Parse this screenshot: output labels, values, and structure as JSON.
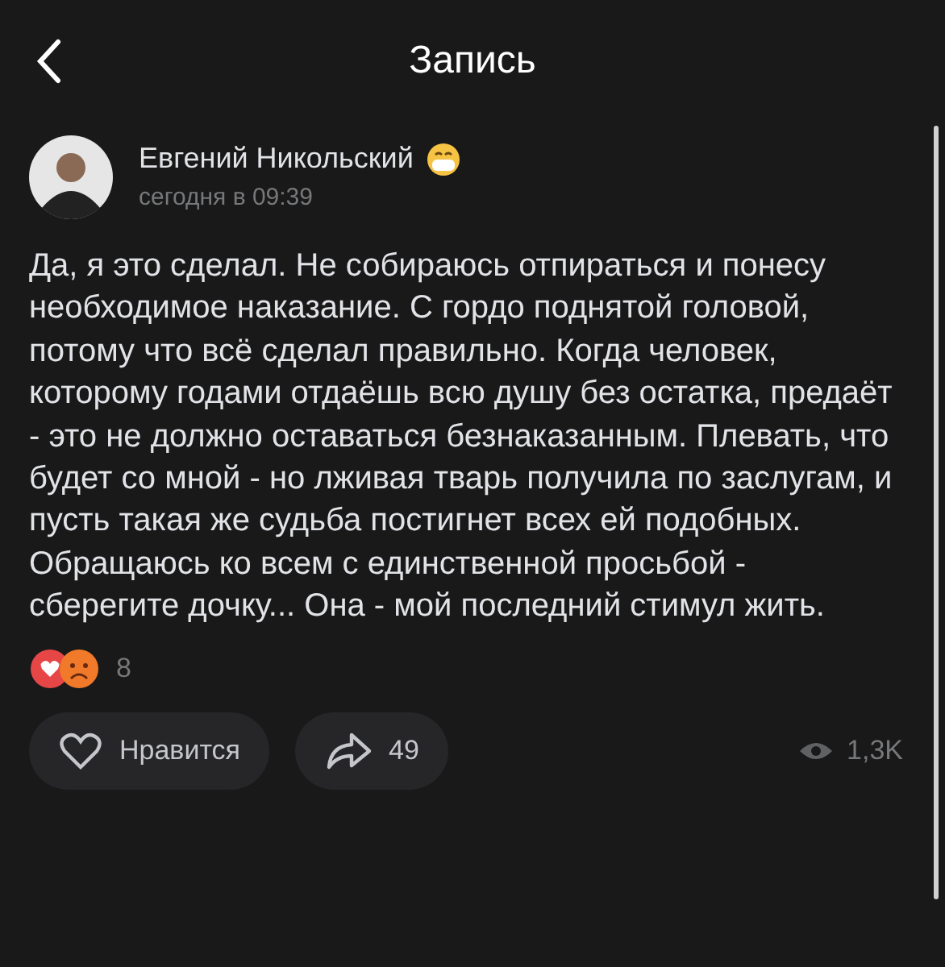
{
  "header": {
    "title": "Запись"
  },
  "post": {
    "author": "Евгений Никольский",
    "time": "сегодня в 09:39",
    "text": "Да, я это сделал. Не собираюсь отпираться и понесу необходимое наказание. С гордо поднятой головой, потому что всё сделал правильно. Когда человек, которому годами отдаёшь всю душу без остатка, предаёт - это не должно оставаться безнаказанным. Плевать, что будет со мной - но лживая тварь получила по заслугам, и пусть такая же судьба постигнет всех ей подобных. Обращаюсь ко всем с единственной просьбой - сберегите дочку... Она - мой последний стимул жить.",
    "reactions_count": "8"
  },
  "actions": {
    "like": "Нравится",
    "shares": "49",
    "views": "1,3K"
  }
}
